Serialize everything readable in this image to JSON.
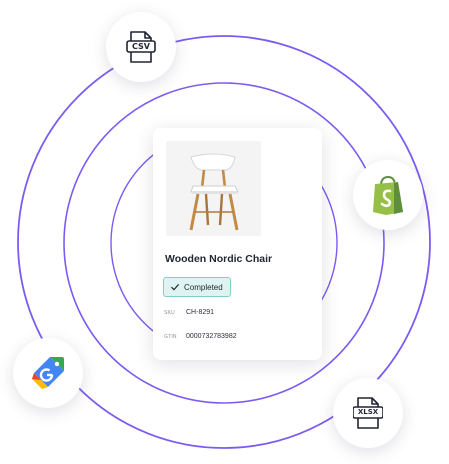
{
  "product": {
    "name": "Wooden Nordic Chair",
    "status": "Completed",
    "sku_label": "SKU",
    "sku": "CH-8291",
    "gtin_label": "GTIN",
    "gtin": "0000732783982"
  },
  "integrations": {
    "csv_label": "CSV",
    "xlsx_label": "XLSX",
    "shopify_icon": "shopify-bag-icon",
    "google_shopping_icon": "google-shopping-tag-icon"
  },
  "colors": {
    "ring": "#7b5cf2",
    "badge_bg": "#dff3f1",
    "badge_border": "#7fd0c6",
    "shopify_green": "#95bf47"
  }
}
